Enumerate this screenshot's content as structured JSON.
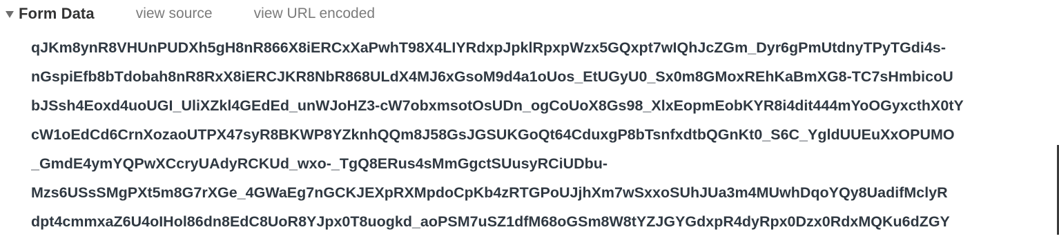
{
  "section": {
    "title": "Form Data",
    "links": [
      "view source",
      "view URL encoded"
    ]
  },
  "payload": {
    "lines": [
      "qJKm8ynR8VHUnPUDXh5gH8nR866X8iERCxXaPwhT98X4LIYRdxpJpklRpxpWzx5GQxpt7wIQhJcZGm_Dyr6gPmUtdnyTPyTGdi4s-",
      "nGspiEfb8bTdobah8nR8RxX8iERCJKR8NbR868ULdX4MJ6xGsoM9d4a1oUos_EtUGyU0_Sx0m8GMoxREhKaBmXG8-TC7sHmbicoU",
      "bJSsh4Eoxd4uoUGI_UliXZkl4GEdEd_unWJoHZ3-cW7obxmsotOsUDn_ogCoUoX8Gs98_XlxEopmEobKYR8i4dit444mYoOGyxcthX0tY",
      "cW1oEdCd6CrnXozaoUTPX47syR8BKWP8YZknhQQm8J58GsJGSUKGoQt64CduxgP8bTsnfxdtbQGnKt0_S6C_YgldUUEuXxOPUMO",
      "_GmdE4ymYQPwXCcryUAdyRCKUd_wxo-_TgQ8ERus4sMmGgctSUusyRCiUDbu-",
      "Mzs6USsSMgPXt5m8G7rXGe_4GWaEg7nGCKJEXpRXMpdoCpKb4zRTGPoUJjhXm7wSxxoSUhJUa3m4MUwhDqoYQy8UadifMclyR",
      "dpt4cmmxaZ6U4oIHol86dn8EdC8UoR8YJpx0T8uogkd_aoPSM7uSZ1dfM68oGSm8W8tYZJGYGdxpR4dyRpx0Dzx0RdxMQKu6dZGY"
    ]
  }
}
